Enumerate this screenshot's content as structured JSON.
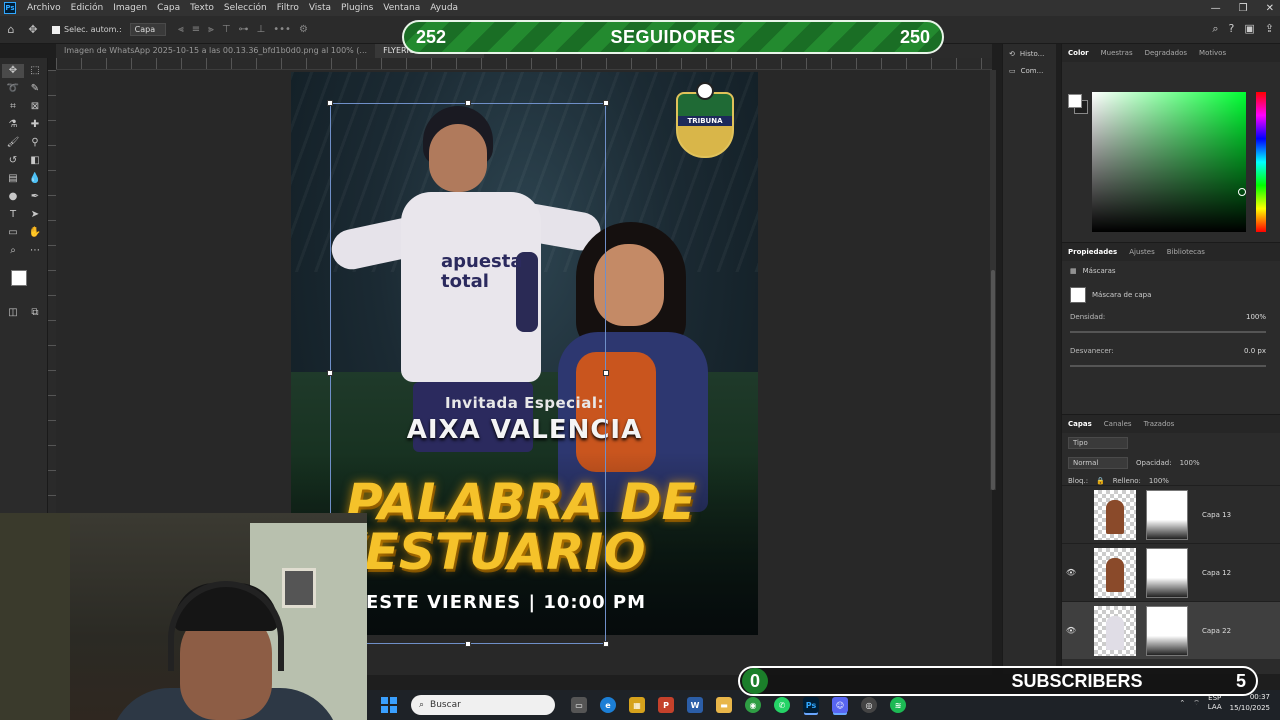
{
  "app": {
    "menu": [
      "Archivo",
      "Edición",
      "Imagen",
      "Capa",
      "Texto",
      "Selección",
      "Filtro",
      "Vista",
      "Plugins",
      "Ventana",
      "Ayuda"
    ]
  },
  "options_bar": {
    "auto_select_label": "Selec. autom.:",
    "auto_select_value": "Capa"
  },
  "tabs": [
    {
      "label": "Imagen de WhatsApp 2025-10-15 a las 00.13.36_bfd1b0d0.png al 100% (..."
    },
    {
      "label": "FLYERIG-PALABRA..."
    }
  ],
  "canvas": {
    "ruler_ticks": [
      "450",
      "400",
      "350",
      "300",
      "250",
      "200",
      "150",
      "100",
      "50",
      "0",
      "50",
      "100",
      "150",
      "200",
      "250",
      "300",
      "350",
      "400",
      "450",
      "500",
      "550",
      "600",
      "650",
      "700",
      "750",
      "800",
      "850",
      "900",
      "950"
    ]
  },
  "artwork": {
    "logo_text": "TRIBUNA",
    "sponsor_line1": "apuesta",
    "sponsor_line2": "total",
    "invitada": "Invitada Especial:",
    "guest_name": "AIXA VALENCIA",
    "headline_line1": "PALABRA DE",
    "headline_line2": "VESTUARIO",
    "event_time": "ESTE VIERNES | 10:00 PM"
  },
  "overlays": {
    "followers_left": "252",
    "followers_label": "SEGUIDORES",
    "followers_right": "250",
    "subs_left": "0",
    "subs_label": "SUBSCRIBERS",
    "subs_right": "5"
  },
  "side_panel": {
    "items": [
      "Histo...",
      "Com..."
    ]
  },
  "color_panel": {
    "tabs": [
      "Color",
      "Muestras",
      "Degradados",
      "Motivos"
    ],
    "picker_hue": "#00ff33"
  },
  "properties_panel": {
    "tabs": [
      "Propiedades",
      "Ajustes",
      "Bibliotecas"
    ],
    "masks_label": "Máscaras",
    "layer_mask_label": "Máscara de capa",
    "density_label": "Densidad:",
    "density_value": "100%",
    "feather_label": "Desvanecer:",
    "feather_value": "0.0 px"
  },
  "layers_panel": {
    "tabs": [
      "Capas",
      "Canales",
      "Trazados"
    ],
    "filter_label": "Tipo",
    "blend_mode": "Normal",
    "opacity_label": "Opacidad:",
    "opacity_value": "100%",
    "lock_label": "Bloq.:",
    "fill_label": "Relleno:",
    "fill_value": "100%",
    "layers": [
      {
        "name": "Capa 13",
        "visible": false
      },
      {
        "name": "Capa 12",
        "visible": true
      },
      {
        "name": "Capa 22",
        "visible": true,
        "selected": true
      }
    ]
  },
  "taskbar": {
    "search_placeholder": "Buscar",
    "lang_line1": "ESP",
    "lang_line2": "LAA",
    "time": "00:37",
    "date": "15/10/2025"
  }
}
